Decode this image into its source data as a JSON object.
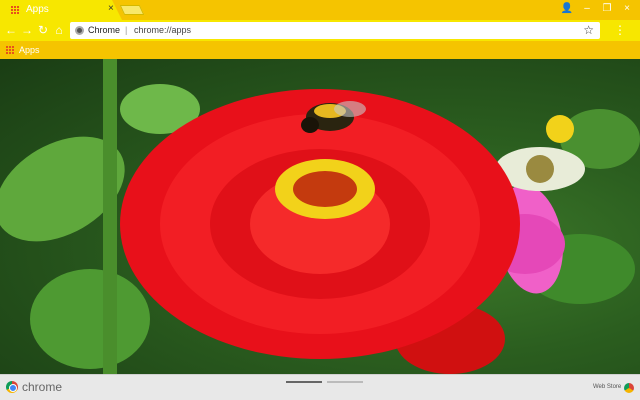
{
  "tab": {
    "title": "Apps",
    "close": "×",
    "icon": "apps-grid-icon"
  },
  "window_controls": {
    "user": "👤",
    "minimize": "–",
    "restore": "❐",
    "close": "×"
  },
  "toolbar": {
    "back": "←",
    "forward": "→",
    "reload": "↻",
    "home": "⌂",
    "omnibox_label": "Chrome",
    "omnibox_separator": "|",
    "url": "chrome://apps",
    "star": "☆",
    "menu": "⋮"
  },
  "bookmarks": {
    "apps_label": "Apps"
  },
  "content": {
    "top_right_lines": [
      "",
      ""
    ]
  },
  "shelf": {
    "brand": "chrome",
    "webstore": "Web Store"
  },
  "colors": {
    "tabstrip": "#f5c400",
    "tab": "#f7e700",
    "petal": "#e8101a",
    "center": "#f2d21a"
  }
}
